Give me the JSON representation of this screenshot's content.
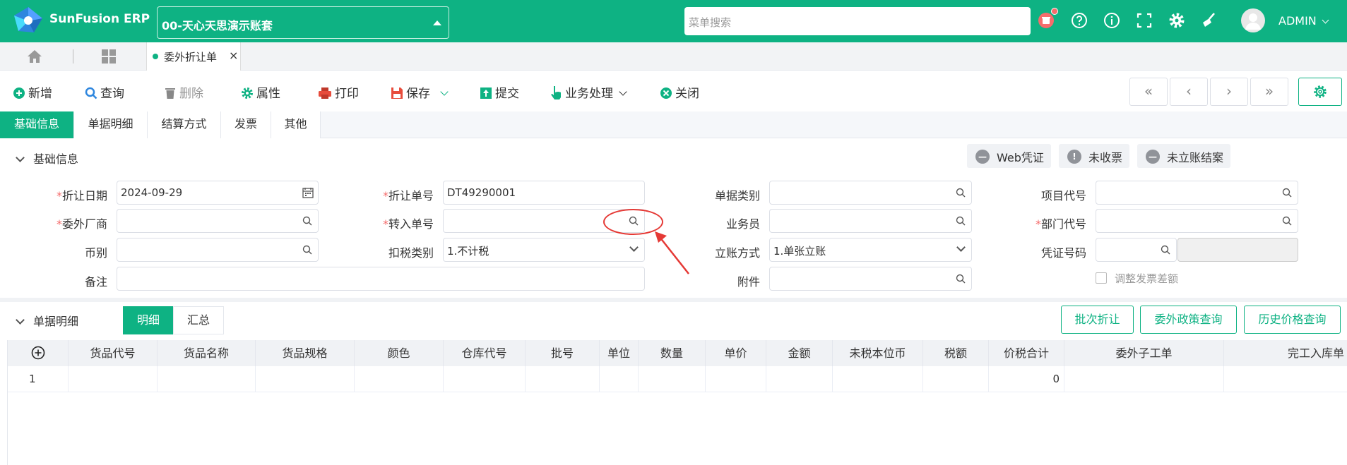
{
  "app": {
    "brand": "SunFusion ERP",
    "account": "00-天心天思演示账套",
    "search_placeholder": "菜单搜索",
    "user": "ADMIN"
  },
  "tabs": {
    "open_tab": "委外折让单",
    "close": "×"
  },
  "toolbar": {
    "add": "新增",
    "query": "查询",
    "delete": "删除",
    "properties": "属性",
    "print": "打印",
    "save": "保存",
    "submit": "提交",
    "business": "业务处理",
    "close": "关闭",
    "nav": [
      "«",
      "‹",
      "›",
      "»"
    ]
  },
  "section_tabs": [
    "基础信息",
    "单据明细",
    "结算方式",
    "发票",
    "其他"
  ],
  "basic": {
    "title": "基础信息",
    "status_buttons": [
      "Web凭证",
      "未收票",
      "未立账结案"
    ],
    "fields": {
      "discount_date": {
        "label": "折让日期",
        "value": "2024-09-29"
      },
      "discount_no": {
        "label": "折让单号",
        "value": "DT49290001"
      },
      "doc_type": {
        "label": "单据类别",
        "value": ""
      },
      "project_code": {
        "label": "项目代号",
        "value": ""
      },
      "vendor": {
        "label": "委外厂商",
        "value": ""
      },
      "transfer_no": {
        "label": "转入单号",
        "value": ""
      },
      "salesman": {
        "label": "业务员",
        "value": ""
      },
      "dept_code": {
        "label": "部门代号",
        "value": ""
      },
      "currency": {
        "label": "币别",
        "value": ""
      },
      "tax_type": {
        "label": "扣税类别",
        "value": "1.不计税"
      },
      "account_method": {
        "label": "立账方式",
        "value": "1.单张立账"
      },
      "voucher_no": {
        "label": "凭证号码",
        "value": ""
      },
      "remark": {
        "label": "备注",
        "value": ""
      },
      "attachment": {
        "label": "附件",
        "value": ""
      },
      "adjust_invoice": {
        "label": "调整发票差额",
        "checked": false
      }
    }
  },
  "detail": {
    "title": "单据明细",
    "view_tabs": [
      "明细",
      "汇总"
    ],
    "buttons": [
      "批次折让",
      "委外政策查询",
      "历史价格查询"
    ],
    "columns": [
      "货品代号",
      "货品名称",
      "货品规格",
      "颜色",
      "仓库代号",
      "批号",
      "单位",
      "数量",
      "单价",
      "金额",
      "未税本位币",
      "税额",
      "价税合计",
      "委外子工单",
      "完工入库单"
    ],
    "rows": [
      {
        "no": "1",
        "total": "0"
      }
    ]
  }
}
